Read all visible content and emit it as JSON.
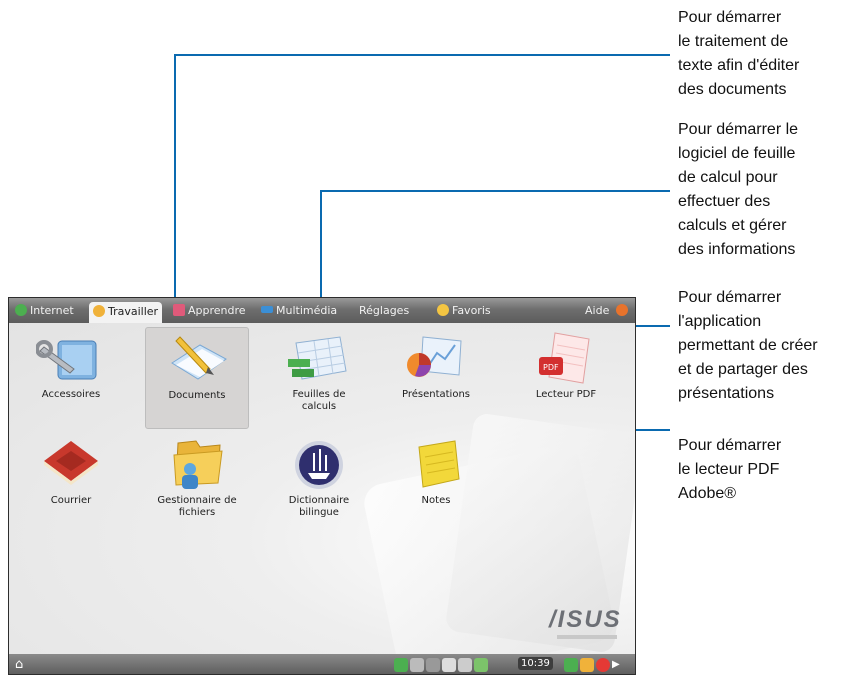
{
  "tabs": [
    {
      "label": "Internet",
      "icon": "internet-icon"
    },
    {
      "label": "Travailler",
      "icon": "work-icon"
    },
    {
      "label": "Apprendre",
      "icon": "learn-icon"
    },
    {
      "label": "Multimédia",
      "icon": "multimedia-icon"
    },
    {
      "label": "Réglages",
      "icon": "settings-icon"
    },
    {
      "label": "Favoris",
      "icon": "favorites-icon"
    },
    {
      "label": "Aide",
      "icon": "help-icon"
    }
  ],
  "apps": [
    {
      "label": "Accessoires",
      "icon": "accessories-icon"
    },
    {
      "label": "Documents",
      "icon": "documents-icon"
    },
    {
      "label": "Feuilles de\ncalculs",
      "icon": "spreadsheet-icon"
    },
    {
      "label": "Présentations",
      "icon": "presentations-icon"
    },
    {
      "label": "Lecteur PDF",
      "icon": "pdf-reader-icon"
    },
    {
      "label": "Courrier",
      "icon": "mail-icon"
    },
    {
      "label": "Gestionnaire de\nfichiers",
      "icon": "file-manager-icon"
    },
    {
      "label": "Dictionnaire\nbilingue",
      "icon": "dictionary-icon"
    },
    {
      "label": "Notes",
      "icon": "notes-icon"
    }
  ],
  "brand": "/ISUS",
  "taskbar": {
    "clock": "10:39",
    "home_icon": "home-icon"
  },
  "callouts": [
    "Pour démarrer\nle traitement de\ntexte afin d'éditer\ndes documents",
    "Pour démarrer le\nlogiciel de feuille\nde calcul pour\neffectuer des\ncalculs et gérer\ndes informations",
    "Pour démarrer\nl'application\npermettant de créer\net de partager des\nprésentations",
    "Pour démarrer\nle lecteur PDF\nAdobe®"
  ],
  "colors": {
    "callout_line": "#0a6ab0",
    "tabbar": "#6e6e6e",
    "taskbar": "#5a5a5a"
  }
}
